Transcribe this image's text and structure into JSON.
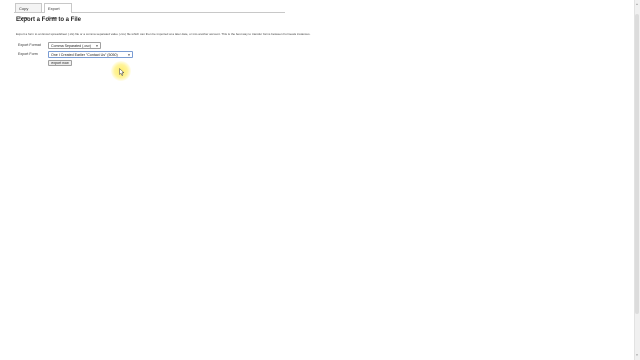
{
  "tabs": [
    {
      "label": "Copy Form",
      "active": false
    },
    {
      "label": "Export Form",
      "active": true
    }
  ],
  "page": {
    "title": "Export a Form to a File",
    "description": "Export a form to an Excel spreadsheet (.xls) file or a comma separated value (.csv) file which can then be imported at a later date, or into another account. This is the best way to transfer forms between Formeats instances."
  },
  "form": {
    "format_label": "Export Format",
    "format_value": "Comma Separated (.csv)",
    "form_label": "Export Form",
    "form_value": "One I Created Earlier \"Contact Us\" (5050)",
    "export_button": "export now"
  },
  "icons": {
    "dropdown": "chevron-down-icon",
    "cursor": "mouse-pointer-icon"
  },
  "colors": {
    "cursor_highlight": "#ffe94f",
    "focus_border": "#7a9cd3"
  }
}
